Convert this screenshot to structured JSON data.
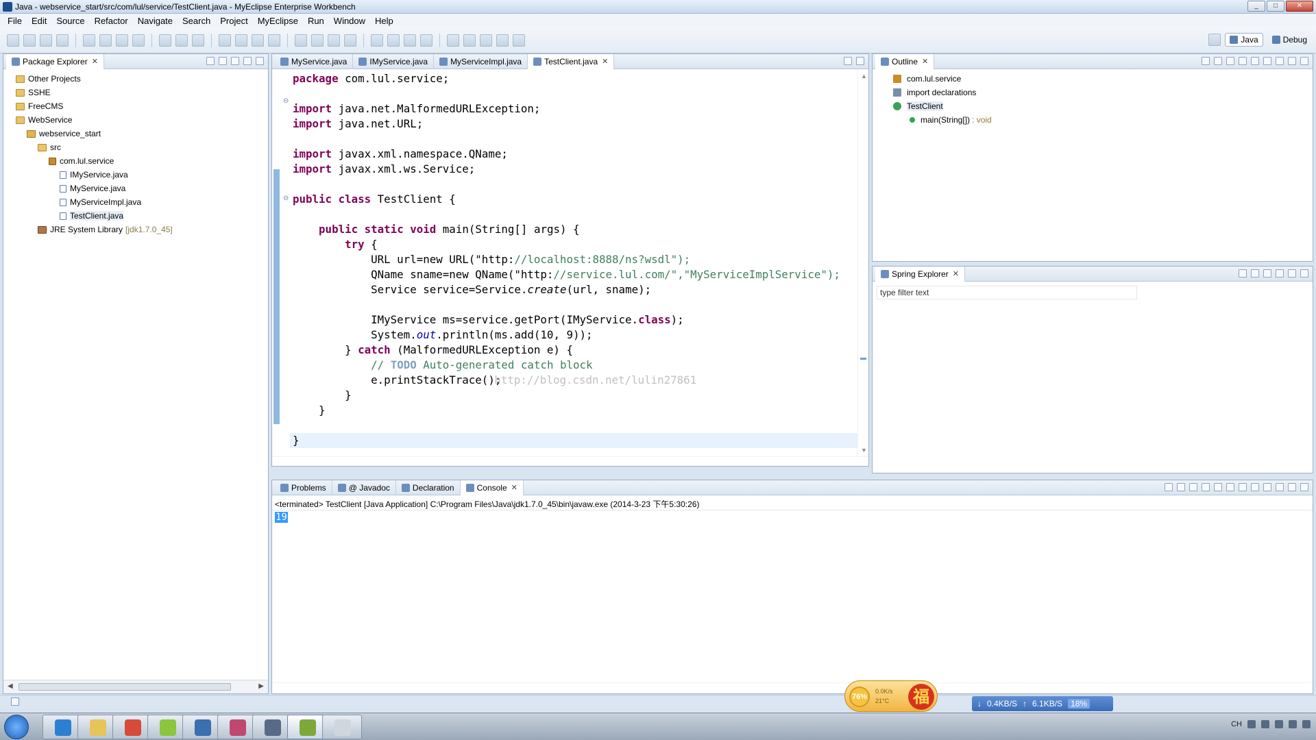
{
  "window": {
    "title": "Java - webservice_start/src/com/lul/service/TestClient.java - MyEclipse Enterprise Workbench"
  },
  "menu": [
    "File",
    "Edit",
    "Source",
    "Refactor",
    "Navigate",
    "Search",
    "Project",
    "MyEclipse",
    "Run",
    "Window",
    "Help"
  ],
  "perspectives": [
    {
      "label": "Java",
      "active": true
    },
    {
      "label": "Debug",
      "active": false
    }
  ],
  "package_explorer": {
    "title": "Package Explorer",
    "tree": [
      {
        "label": "Other Projects",
        "indent": 0,
        "icon": "folder-icon",
        "kind": "folder"
      },
      {
        "label": "SSHE",
        "indent": 0,
        "icon": "folder-icon",
        "kind": "folder"
      },
      {
        "label": "FreeCMS",
        "indent": 0,
        "icon": "folder-icon",
        "kind": "folder"
      },
      {
        "label": "WebService",
        "indent": 0,
        "icon": "folder-icon",
        "kind": "folder"
      },
      {
        "label": "webservice_start",
        "indent": 1,
        "icon": "project-icon",
        "kind": "project"
      },
      {
        "label": "src",
        "indent": 2,
        "icon": "source-folder-icon",
        "kind": "folder"
      },
      {
        "label": "com.lul.service",
        "indent": 3,
        "icon": "package-icon",
        "kind": "pkg"
      },
      {
        "label": "IMyService.java",
        "indent": 4,
        "icon": "java-file-icon",
        "kind": "java"
      },
      {
        "label": "MyService.java",
        "indent": 4,
        "icon": "java-file-icon",
        "kind": "java"
      },
      {
        "label": "MyServiceImpl.java",
        "indent": 4,
        "icon": "java-file-icon",
        "kind": "java"
      },
      {
        "label": "TestClient.java",
        "indent": 4,
        "icon": "java-file-icon",
        "kind": "java",
        "selected": true
      },
      {
        "label": "JRE System Library",
        "suffix": "[jdk1.7.0_45]",
        "indent": 2,
        "icon": "library-icon",
        "kind": "jar"
      }
    ]
  },
  "editor": {
    "tabs": [
      {
        "label": "MyService.java",
        "active": false
      },
      {
        "label": "IMyService.java",
        "active": false
      },
      {
        "label": "MyServiceImpl.java",
        "active": false
      },
      {
        "label": "TestClient.java",
        "active": true
      }
    ],
    "code_lines": [
      "package com.lul.service;",
      "",
      "import java.net.MalformedURLException;",
      "import java.net.URL;",
      "",
      "import javax.xml.namespace.QName;",
      "import javax.xml.ws.Service;",
      "",
      "public class TestClient {",
      "",
      "    public static void main(String[] args) {",
      "        try {",
      "            URL url=new URL(\"http://localhost:8888/ns?wsdl\");",
      "            QName sname=new QName(\"http://service.lul.com/\",\"MyServiceImplService\");",
      "            Service service=Service.create(url, sname);",
      "",
      "            IMyService ms=service.getPort(IMyService.class);",
      "            System.out.println(ms.add(10, 9));",
      "        } catch (MalformedURLException e) {",
      "            // TODO Auto-generated catch block",
      "            e.printStackTrace();",
      "        }",
      "    }",
      "",
      "}"
    ],
    "watermark": "http://blog.csdn.net/lulin27861"
  },
  "outline": {
    "title": "Outline",
    "items": [
      {
        "label": "com.lul.service",
        "indent": 0,
        "icon": "package-icon",
        "kind": "pkg"
      },
      {
        "label": "import declarations",
        "indent": 0,
        "icon": "imports-icon",
        "kind": "imp"
      },
      {
        "label": "TestClient",
        "indent": 0,
        "icon": "class-icon",
        "kind": "cls",
        "selected": true
      },
      {
        "label": "main(String[])",
        "type": ": void",
        "indent": 1,
        "icon": "method-icon",
        "kind": "meth"
      }
    ]
  },
  "spring_explorer": {
    "title": "Spring Explorer",
    "filter_placeholder": "type filter text"
  },
  "bottom_panel": {
    "tabs": [
      {
        "label": "Problems",
        "active": false
      },
      {
        "label": "@ Javadoc",
        "active": false
      },
      {
        "label": "Declaration",
        "active": false
      },
      {
        "label": "Console",
        "active": true
      }
    ],
    "header": "<terminated> TestClient [Java Application] C:\\Program Files\\Java\\jdk1.7.0_45\\bin\\javaw.exe (2014-3-23 下午5:30:26)",
    "output": "19"
  },
  "widgets": {
    "cpu_percent": "76%",
    "net_rates": [
      "0.0K/s",
      "21°C"
    ],
    "fu_char": "福",
    "speed_down": "0.4KB/S",
    "speed_up": "6.1KB/S",
    "speed_pct": "18%"
  },
  "taskbar": {
    "apps": [
      "internet-explorer-icon",
      "file-explorer-icon",
      "chrome-icon",
      "leaf-app-icon",
      "myeclipse-icon",
      "database-icon",
      "settings-icon",
      "notepad-icon",
      "paint-icon"
    ],
    "tray_lang": "CH"
  }
}
